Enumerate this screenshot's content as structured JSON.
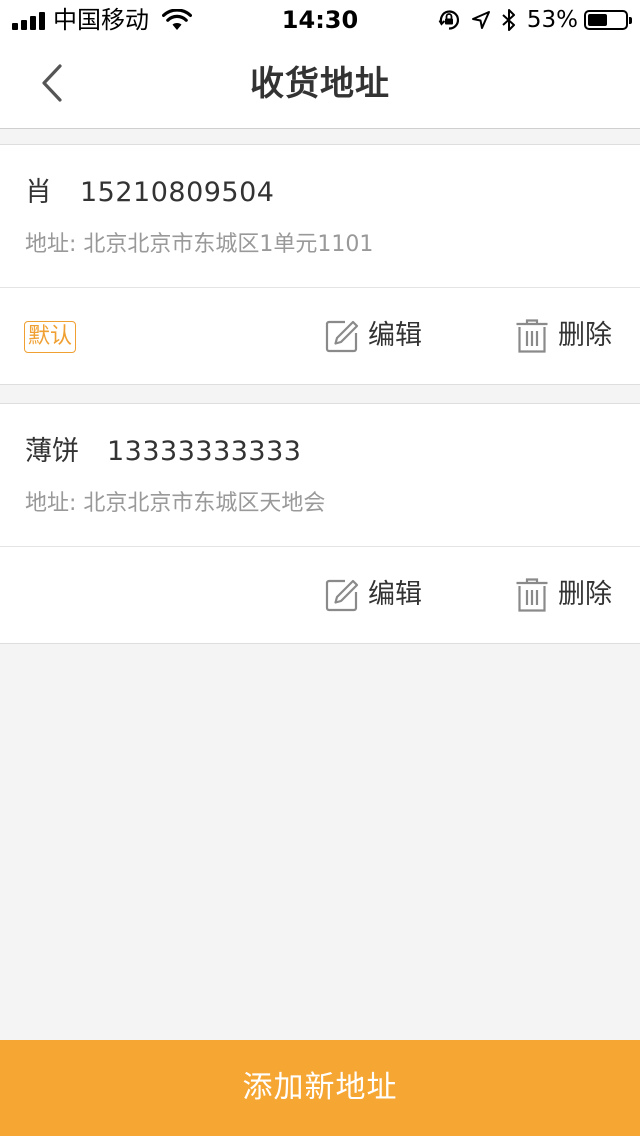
{
  "status_bar": {
    "carrier": "中国移动",
    "time": "14:30",
    "battery_percent": "53%",
    "battery_level": 0.53,
    "icons": [
      "signal-icon",
      "wifi-icon",
      "orientation-lock-icon",
      "location-icon",
      "bluetooth-icon",
      "battery-icon"
    ]
  },
  "nav": {
    "title": "收货地址",
    "back_icon": "chevron-left-icon"
  },
  "addresses": [
    {
      "name": "肖",
      "phone": "15210809504",
      "address": "地址: 北京北京市东城区1单元1101",
      "is_default": true,
      "default_label": "默认",
      "edit_label": "编辑",
      "delete_label": "删除"
    },
    {
      "name": "薄饼",
      "phone": "13333333333",
      "address": "地址: 北京北京市东城区天地会",
      "is_default": false,
      "edit_label": "编辑",
      "delete_label": "删除"
    }
  ],
  "footer": {
    "add_button_label": "添加新地址"
  },
  "colors": {
    "accent": "#f6a632",
    "default_badge": "#f0a032",
    "page_background": "#f4f4f4",
    "secondary_text": "#999999"
  }
}
